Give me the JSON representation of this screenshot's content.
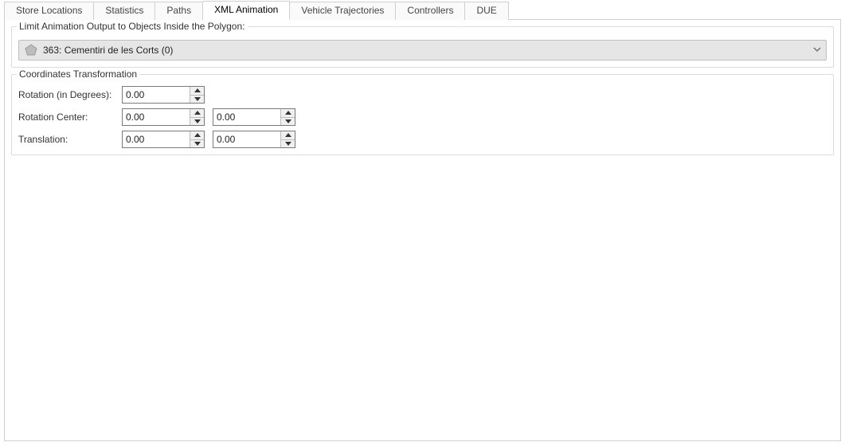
{
  "tabs": [
    {
      "label": "Store Locations"
    },
    {
      "label": "Statistics"
    },
    {
      "label": "Paths"
    },
    {
      "label": "XML Animation",
      "active": true
    },
    {
      "label": "Vehicle Trajectories"
    },
    {
      "label": "Controllers"
    },
    {
      "label": "DUE"
    }
  ],
  "polygon_group": {
    "legend": "Limit Animation Output to Objects Inside the Polygon:",
    "selected_text": "363: Cementiri de les Corts (0)"
  },
  "coords_group": {
    "legend": "Coordinates Transformation",
    "rows": {
      "rotation_deg": {
        "label": "Rotation (in Degrees):",
        "value": "0.00"
      },
      "rotation_center": {
        "label": "Rotation Center:",
        "x": "0.00",
        "y": "0.00"
      },
      "translation": {
        "label": "Translation:",
        "x": "0.00",
        "y": "0.00"
      }
    }
  }
}
